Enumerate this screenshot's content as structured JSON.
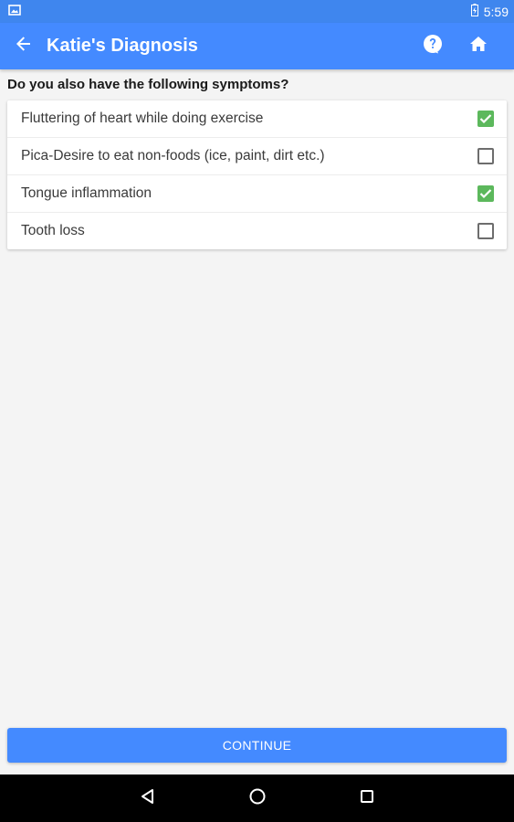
{
  "status_bar": {
    "time": "5:59",
    "notification_icon": "image-icon",
    "battery_icon": "battery-icon"
  },
  "app_bar": {
    "title": "Katie's Diagnosis",
    "back_icon": "arrow-back-icon",
    "help_icon": "help-icon",
    "home_icon": "home-icon"
  },
  "question": "Do you also have the following symptoms?",
  "symptoms": [
    {
      "label": "Fluttering of heart while doing exercise",
      "checked": true
    },
    {
      "label": "Pica-Desire to eat non-foods (ice, paint, dirt etc.)",
      "checked": false
    },
    {
      "label": "Tongue inflammation",
      "checked": true
    },
    {
      "label": "Tooth loss",
      "checked": false
    }
  ],
  "continue_label": "CONTINUE",
  "nav": {
    "back_icon": "nav-back-icon",
    "home_icon": "nav-home-icon",
    "recents_icon": "nav-recents-icon"
  },
  "colors": {
    "primary": "#448aff",
    "check": "#5cb85c"
  }
}
